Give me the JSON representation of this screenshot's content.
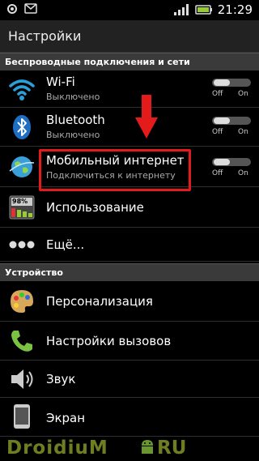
{
  "status": {
    "time": "21:29"
  },
  "header": {
    "title": "Настройки"
  },
  "sections": {
    "wireless": "Беспроводные подключения и сети",
    "device": "Устройство"
  },
  "wireless_items": [
    {
      "label": "Wi-Fi",
      "sub": "Выключено",
      "toggle_off": "Off",
      "toggle_on": "On"
    },
    {
      "label": "Bluetooth",
      "sub": "Выключено",
      "toggle_off": "Off",
      "toggle_on": "On"
    },
    {
      "label": "Мобильный интернет",
      "sub": "Подключиться к интернету",
      "toggle_off": "Off",
      "toggle_on": "On"
    },
    {
      "label": "Использование",
      "battery_text": "98%"
    },
    {
      "label": "Ещё..."
    }
  ],
  "device_items": [
    {
      "label": "Персонализация"
    },
    {
      "label": "Настройки вызовов"
    },
    {
      "label": "Звук"
    },
    {
      "label": "Экран"
    }
  ],
  "watermark": {
    "left": "DroidiuM",
    "right": "RU"
  },
  "colors": {
    "highlight": "#e41b1b",
    "accent": "#2a9fd8",
    "background": "#000000"
  },
  "icons": [
    "settings-icon",
    "message-icon",
    "signal-icon",
    "battery-icon",
    "wifi-icon",
    "bluetooth-icon",
    "globe-icon",
    "usage-icon",
    "more-icon",
    "palette-icon",
    "phone-icon",
    "speaker-icon",
    "display-icon",
    "android-icon"
  ]
}
